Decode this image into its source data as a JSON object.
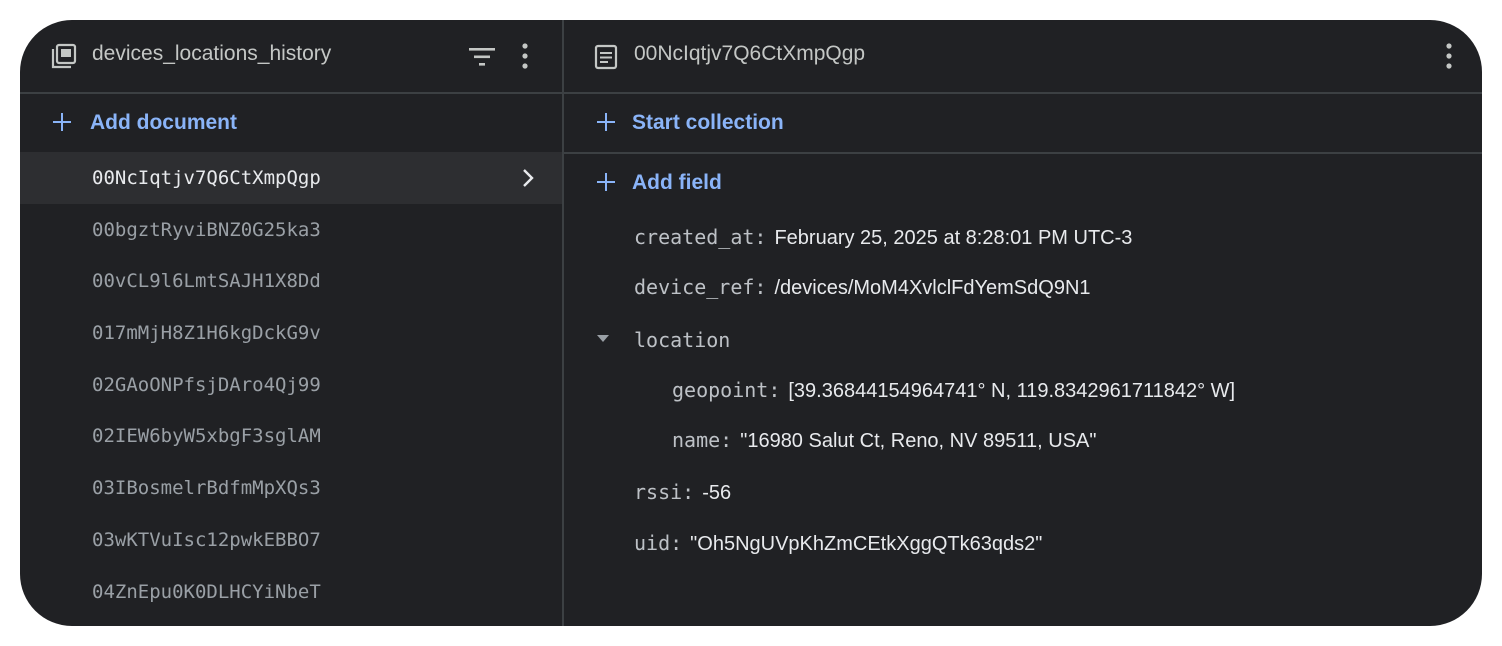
{
  "collection_panel": {
    "title": "devices_locations_history",
    "add_document_label": "Add document",
    "documents": [
      "00NcIqtjv7Q6CtXmpQgp",
      "00bgztRyviBNZ0G25ka3",
      "00vCL9l6LmtSAJH1X8Dd",
      "017mMjH8Z1H6kgDckG9v",
      "02GAoONPfsjDAro4Qj99",
      "02IEW6byW5xbgF3sglAM",
      "03IBosmelrBdfmMpXQs3",
      "03wKTVuIsc12pwkEBBO7",
      "04ZnEpu0K0DLHCYiNbeT"
    ],
    "selected_index": 0
  },
  "document_panel": {
    "title": "00NcIqtjv7Q6CtXmpQgp",
    "start_collection_label": "Start collection",
    "add_field_label": "Add field",
    "fields": {
      "created_at": {
        "key": "created_at:",
        "value": "February 25, 2025 at 8:28:01 PM UTC-3"
      },
      "device_ref": {
        "key": "device_ref:",
        "value": "/devices/MoM4XvlclFdYemSdQ9N1"
      },
      "location": {
        "key": "location",
        "geopoint": {
          "key": "geopoint:",
          "value": "[39.36844154964741° N, 119.8342961711842° W]"
        },
        "name": {
          "key": "name:",
          "value": "\"16980 Salut Ct, Reno, NV 89511, USA\""
        }
      },
      "rssi": {
        "key": "rssi:",
        "value": "-56"
      },
      "uid": {
        "key": "uid:",
        "value": "\"Oh5NgUVpKhZmCEtkXggQTk63qds2\""
      }
    }
  },
  "icons": {
    "collection": "collection-icon",
    "filter": "filter-icon",
    "more": "more-vert-icon",
    "document": "document-icon",
    "chevron": "chevron-right-icon",
    "expand": "expand-triangle-icon",
    "add": "plus-icon"
  },
  "colors": {
    "background": "#202124",
    "accent": "#8ab4f8",
    "selected_row": "#2d2e31",
    "divider": "#3c4043"
  }
}
